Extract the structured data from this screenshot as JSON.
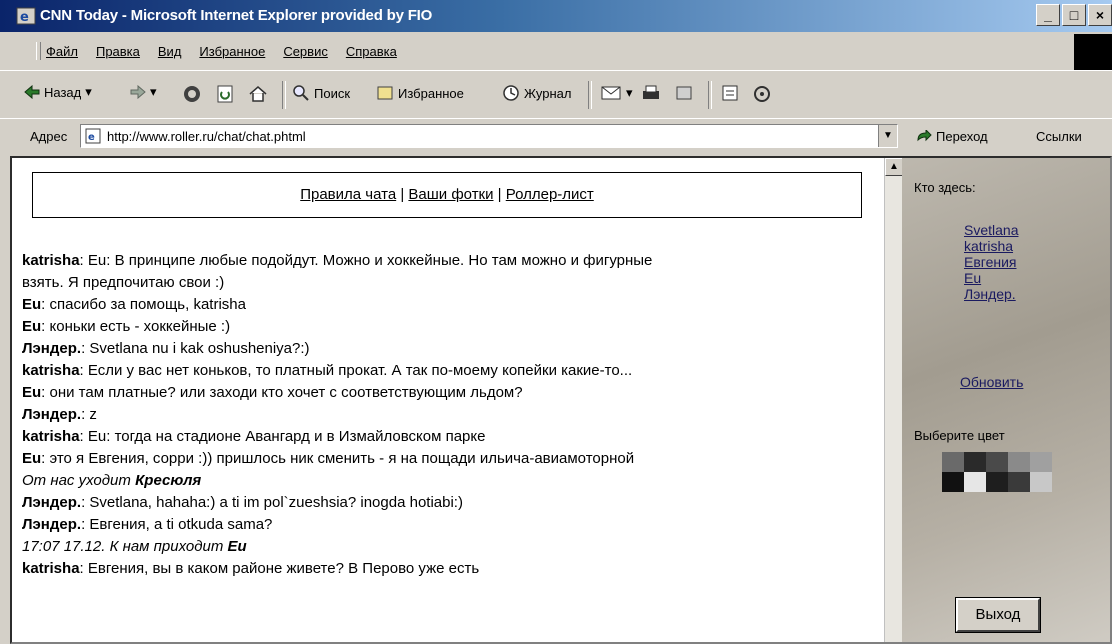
{
  "window": {
    "title": "CNN Today - Microsoft Internet Explorer provided by FIO",
    "buttons": [
      "_",
      "□",
      "×"
    ]
  },
  "menu": [
    "Файл",
    "Правка",
    "Вид",
    "Избранное",
    "Сервис",
    "Справка"
  ],
  "toolbar": {
    "back": "Назад",
    "search": "Поиск",
    "favorites": "Избранное",
    "history": "Журнал"
  },
  "address": {
    "label": "Адрес",
    "url": "http://www.roller.ru/chat/chat.phtml",
    "go": "Переход",
    "links": "Ссылки"
  },
  "chat": {
    "nav": [
      "Правила чата",
      "Ваши фотки",
      "Роллер-лист"
    ],
    "nav_separator": " | ",
    "messages": [
      {
        "user": "katrisha",
        "text": ": Eu: В принципе любые подойдут. Можно и хоккейные. Но там можно и фигурные"
      },
      {
        "user": "",
        "text": "взять. Я предпочитаю свои :)"
      },
      {
        "user": "Eu",
        "text": ": спасибо за помощь, katrisha"
      },
      {
        "user": "Eu",
        "text": ": коньки есть - хоккейные :)"
      },
      {
        "user": "Лэндер.",
        "text": ": Svetlana nu i kak oshusheniya?:)"
      },
      {
        "user": "katrisha",
        "text": ": Если у вас нет коньков, то платный прокат. А так по-моему копейки какие-то..."
      },
      {
        "user": "Eu",
        "text": ": они там платные? или заходи кто хочет с соответствующим льдом?"
      },
      {
        "user": "Лэндер.",
        "text": ": z"
      },
      {
        "user": "katrisha",
        "text": ": Eu: тогда на стадионе Авангард и в Измайловском парке"
      },
      {
        "user": "Eu",
        "text": ": это я Евгения, сорри :)) пришлось ник сменить - я на пощади ильича-авиамоторной"
      },
      {
        "user": "",
        "text": "От нас уходит ",
        "bold_tail": "Кресюля",
        "italic": true
      },
      {
        "user": "Лэндер.",
        "text": ": Svetlana, hahaha:) a ti im pol`zueshsia? inogda hotiabi:)"
      },
      {
        "user": "Лэндер.",
        "text": ": Евгения, a ti otkuda sama?"
      },
      {
        "user": "",
        "text": "17:07 17.12. К нам приходит ",
        "bold_tail": "Eu",
        "italic": true
      },
      {
        "user": "katrisha",
        "text": ": Евгения, вы в каком районе живете? В Перово уже есть"
      }
    ]
  },
  "side": {
    "who_label": "Кто здесь:",
    "users": [
      "Svetlana",
      "katrisha",
      "Евгения",
      "Eu",
      "Лэндер."
    ],
    "refresh": "Обновить",
    "color_label": "Выберите цвет",
    "swatch_colors": [
      "#6a6a6a",
      "#2a2a2a",
      "#4a4a4a",
      "#8a8a8a",
      "#a0a0a0",
      "#111111",
      "#e6e6e6",
      "#1e1e1e",
      "#3a3a3a",
      "#c8c8c8"
    ],
    "exit": "Выход"
  }
}
